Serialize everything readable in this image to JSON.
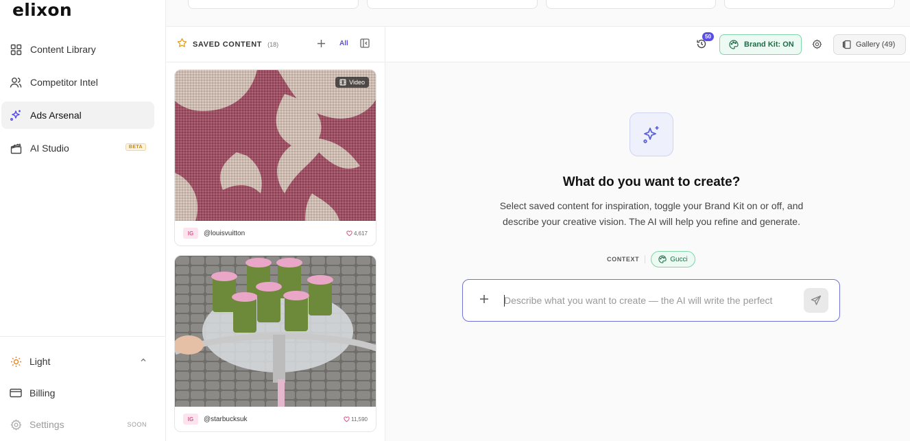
{
  "app": {
    "logo": "elixon"
  },
  "sidebar": {
    "items": [
      {
        "label": "Content Library",
        "icon": "grid-icon"
      },
      {
        "label": "Competitor Intel",
        "icon": "users-icon"
      },
      {
        "label": "Ads Arsenal",
        "icon": "sparkles-icon",
        "active": true
      },
      {
        "label": "AI Studio",
        "icon": "clapperboard-icon",
        "badge": "BETA"
      }
    ],
    "bottom": {
      "theme_label": "Light",
      "billing_label": "Billing",
      "settings_label": "Settings",
      "settings_badge": "SOON"
    }
  },
  "saved": {
    "title": "SAVED CONTENT",
    "count": "(18)",
    "filter_all": "All",
    "cards": [
      {
        "platform": "IG",
        "handle": "@louisvuitton",
        "likes": "4,617",
        "tag": "Video"
      },
      {
        "platform": "IG",
        "handle": "@starbucksuk",
        "likes": "11,590"
      }
    ]
  },
  "main": {
    "history_badge": "50",
    "brandkit_label": "Brand Kit: ON",
    "gallery_label": "Gallery (49)",
    "hero_title": "What do you want to create?",
    "hero_desc": "Select saved content for inspiration, toggle your Brand Kit on or off, and describe your creative vision. The AI will help you refine and generate.",
    "context_label": "CONTEXT",
    "context_chip": "Gucci",
    "prompt_placeholder": "Describe what you want to create — the AI will write the perfect"
  },
  "colors": {
    "accent": "#5b4ee6",
    "brand_green": "#1d6d46",
    "ig_pink": "#d0618f"
  }
}
